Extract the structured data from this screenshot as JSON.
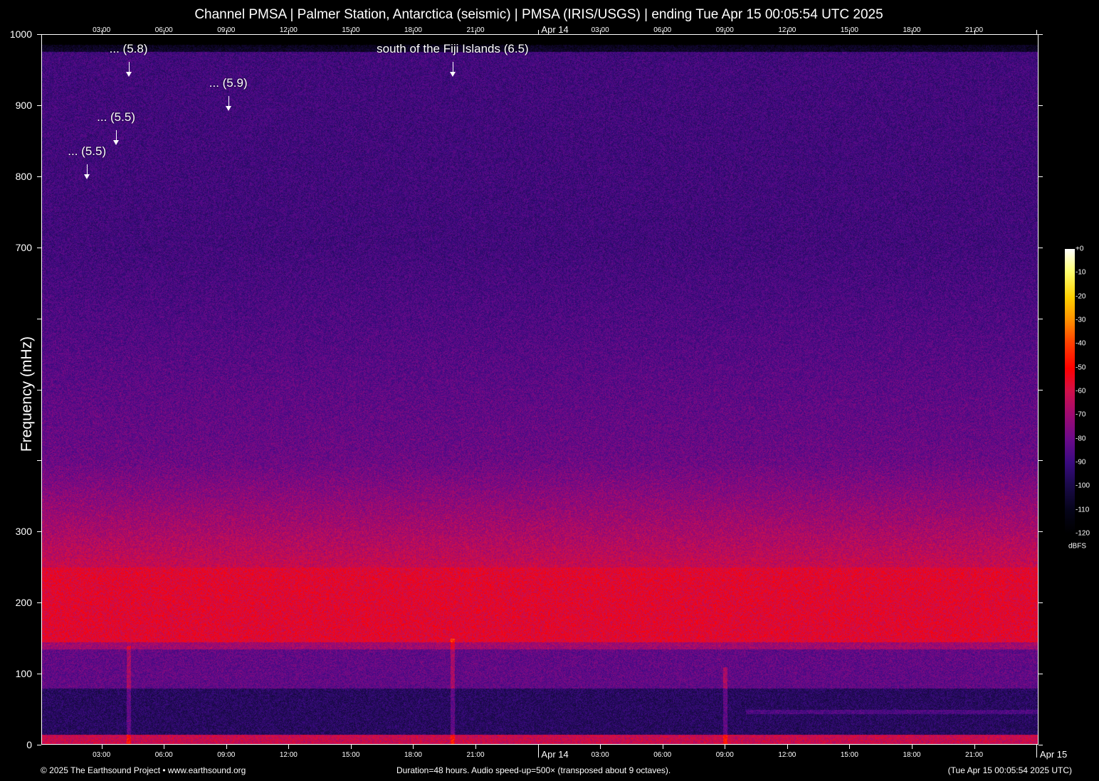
{
  "title": "Channel PMSA | Palmer Station, Antarctica (seismic) | PMSA (IRIS/USGS) | ending Tue Apr 15 00:05:54 UTC 2025",
  "chart_data": {
    "type": "heatmap",
    "title": "Channel PMSA | Palmer Station, Antarctica (seismic) | PMSA (IRIS/USGS) | ending Tue Apr 15 00:05:54 UTC 2025",
    "ylabel": "Frequency (mHz)",
    "ylim": [
      0,
      1000
    ],
    "y_ticks": [
      0,
      100,
      200,
      300,
      400,
      500,
      600,
      700,
      800,
      900,
      1000
    ],
    "y_tick_labels": [
      "0",
      "100",
      "200",
      "300",
      "",
      "",
      "",
      "700",
      "800",
      "900",
      "1000"
    ],
    "x_duration_hours": 48,
    "x_start_offset_hours": 0.1,
    "x_ticks": [
      {
        "h": 3,
        "label": "03:00"
      },
      {
        "h": 6,
        "label": "06:00"
      },
      {
        "h": 9,
        "label": "09:00"
      },
      {
        "h": 12,
        "label": "12:00"
      },
      {
        "h": 15,
        "label": "15:00"
      },
      {
        "h": 18,
        "label": "18:00"
      },
      {
        "h": 21,
        "label": "21:00"
      },
      {
        "h": 24,
        "label": "Apr 14"
      },
      {
        "h": 27,
        "label": "03:00"
      },
      {
        "h": 30,
        "label": "06:00"
      },
      {
        "h": 33,
        "label": "09:00"
      },
      {
        "h": 36,
        "label": "12:00"
      },
      {
        "h": 39,
        "label": "15:00"
      },
      {
        "h": 42,
        "label": "18:00"
      },
      {
        "h": 45,
        "label": "21:00"
      },
      {
        "h": 48,
        "label": "Apr 15"
      }
    ],
    "colorbar": {
      "label": "dBFS",
      "ticks": [
        "+0",
        "-10",
        "-20",
        "-30",
        "-40",
        "-50",
        "-60",
        "-70",
        "-80",
        "-90",
        "-100",
        "-110",
        "-120"
      ],
      "range": [
        -120,
        0
      ]
    },
    "events": [
      {
        "label": "... (5.5)",
        "h": 2.3,
        "level": 795
      },
      {
        "label": "... (5.5)",
        "h": 3.7,
        "level": 843
      },
      {
        "label": "... (5.8)",
        "h": 4.3,
        "level": 939
      },
      {
        "label": "... (5.9)",
        "h": 9.1,
        "level": 891
      },
      {
        "label": "south of the Fiji Islands (6.5)",
        "h": 19.9,
        "level": 939
      }
    ]
  },
  "footer": {
    "copyright": "© 2025 The Earthsound Project • www.earthsound.org",
    "duration": "Duration=48 hours. Audio speed-up=500× (transposed about 9 octaves).",
    "ending": "(Tue Apr 15 00:05:54 2025 UTC)"
  }
}
